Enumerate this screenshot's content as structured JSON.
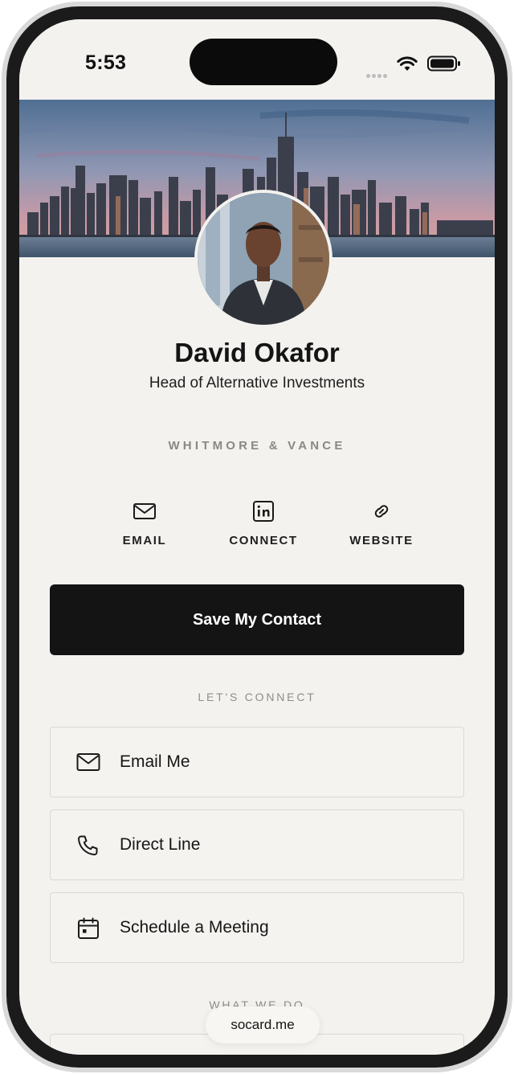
{
  "status_bar": {
    "time": "5:53"
  },
  "profile": {
    "name": "David Okafor",
    "title": "Head of Alternative Investments",
    "company": "WHITMORE & VANCE"
  },
  "quick_actions": [
    {
      "label": "EMAIL",
      "icon": "mail-icon"
    },
    {
      "label": "CONNECT",
      "icon": "linkedin-icon"
    },
    {
      "label": "WEBSITE",
      "icon": "link-icon"
    }
  ],
  "save_button": {
    "label": "Save My Contact"
  },
  "connect_section": {
    "heading": "LET'S CONNECT",
    "items": [
      {
        "label": "Email Me",
        "icon": "mail-icon"
      },
      {
        "label": "Direct Line",
        "icon": "phone-icon"
      },
      {
        "label": "Schedule a Meeting",
        "icon": "calendar-icon"
      }
    ]
  },
  "what_we_do": {
    "heading": "WHAT WE DO"
  },
  "footer": {
    "domain": "socard.me"
  },
  "colors": {
    "background": "#f3f2ef",
    "button": "#141414",
    "muted_text": "#8a8884"
  }
}
